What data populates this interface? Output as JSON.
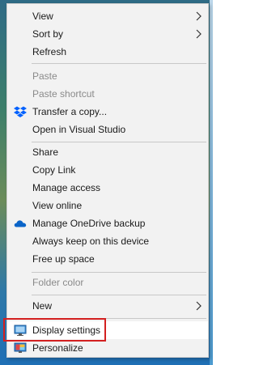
{
  "menu": {
    "view": "View",
    "sort_by": "Sort by",
    "refresh": "Refresh",
    "paste": "Paste",
    "paste_shortcut": "Paste shortcut",
    "transfer_copy": "Transfer a copy...",
    "open_vs": "Open in Visual Studio",
    "share": "Share",
    "copy_link": "Copy Link",
    "manage_access": "Manage access",
    "view_online": "View online",
    "manage_onedrive": "Manage OneDrive backup",
    "always_keep": "Always keep on this device",
    "free_up": "Free up space",
    "folder_color": "Folder color",
    "new": "New",
    "display_settings": "Display settings",
    "personalize": "Personalize"
  },
  "icons": {
    "transfer_copy": "dropbox-icon",
    "manage_onedrive": "onedrive-icon",
    "display_settings": "monitor-icon",
    "personalize": "personalize-icon"
  },
  "colors": {
    "dropbox": "#0061fe",
    "onedrive": "#0a64c8",
    "highlight_box": "#d32020"
  }
}
